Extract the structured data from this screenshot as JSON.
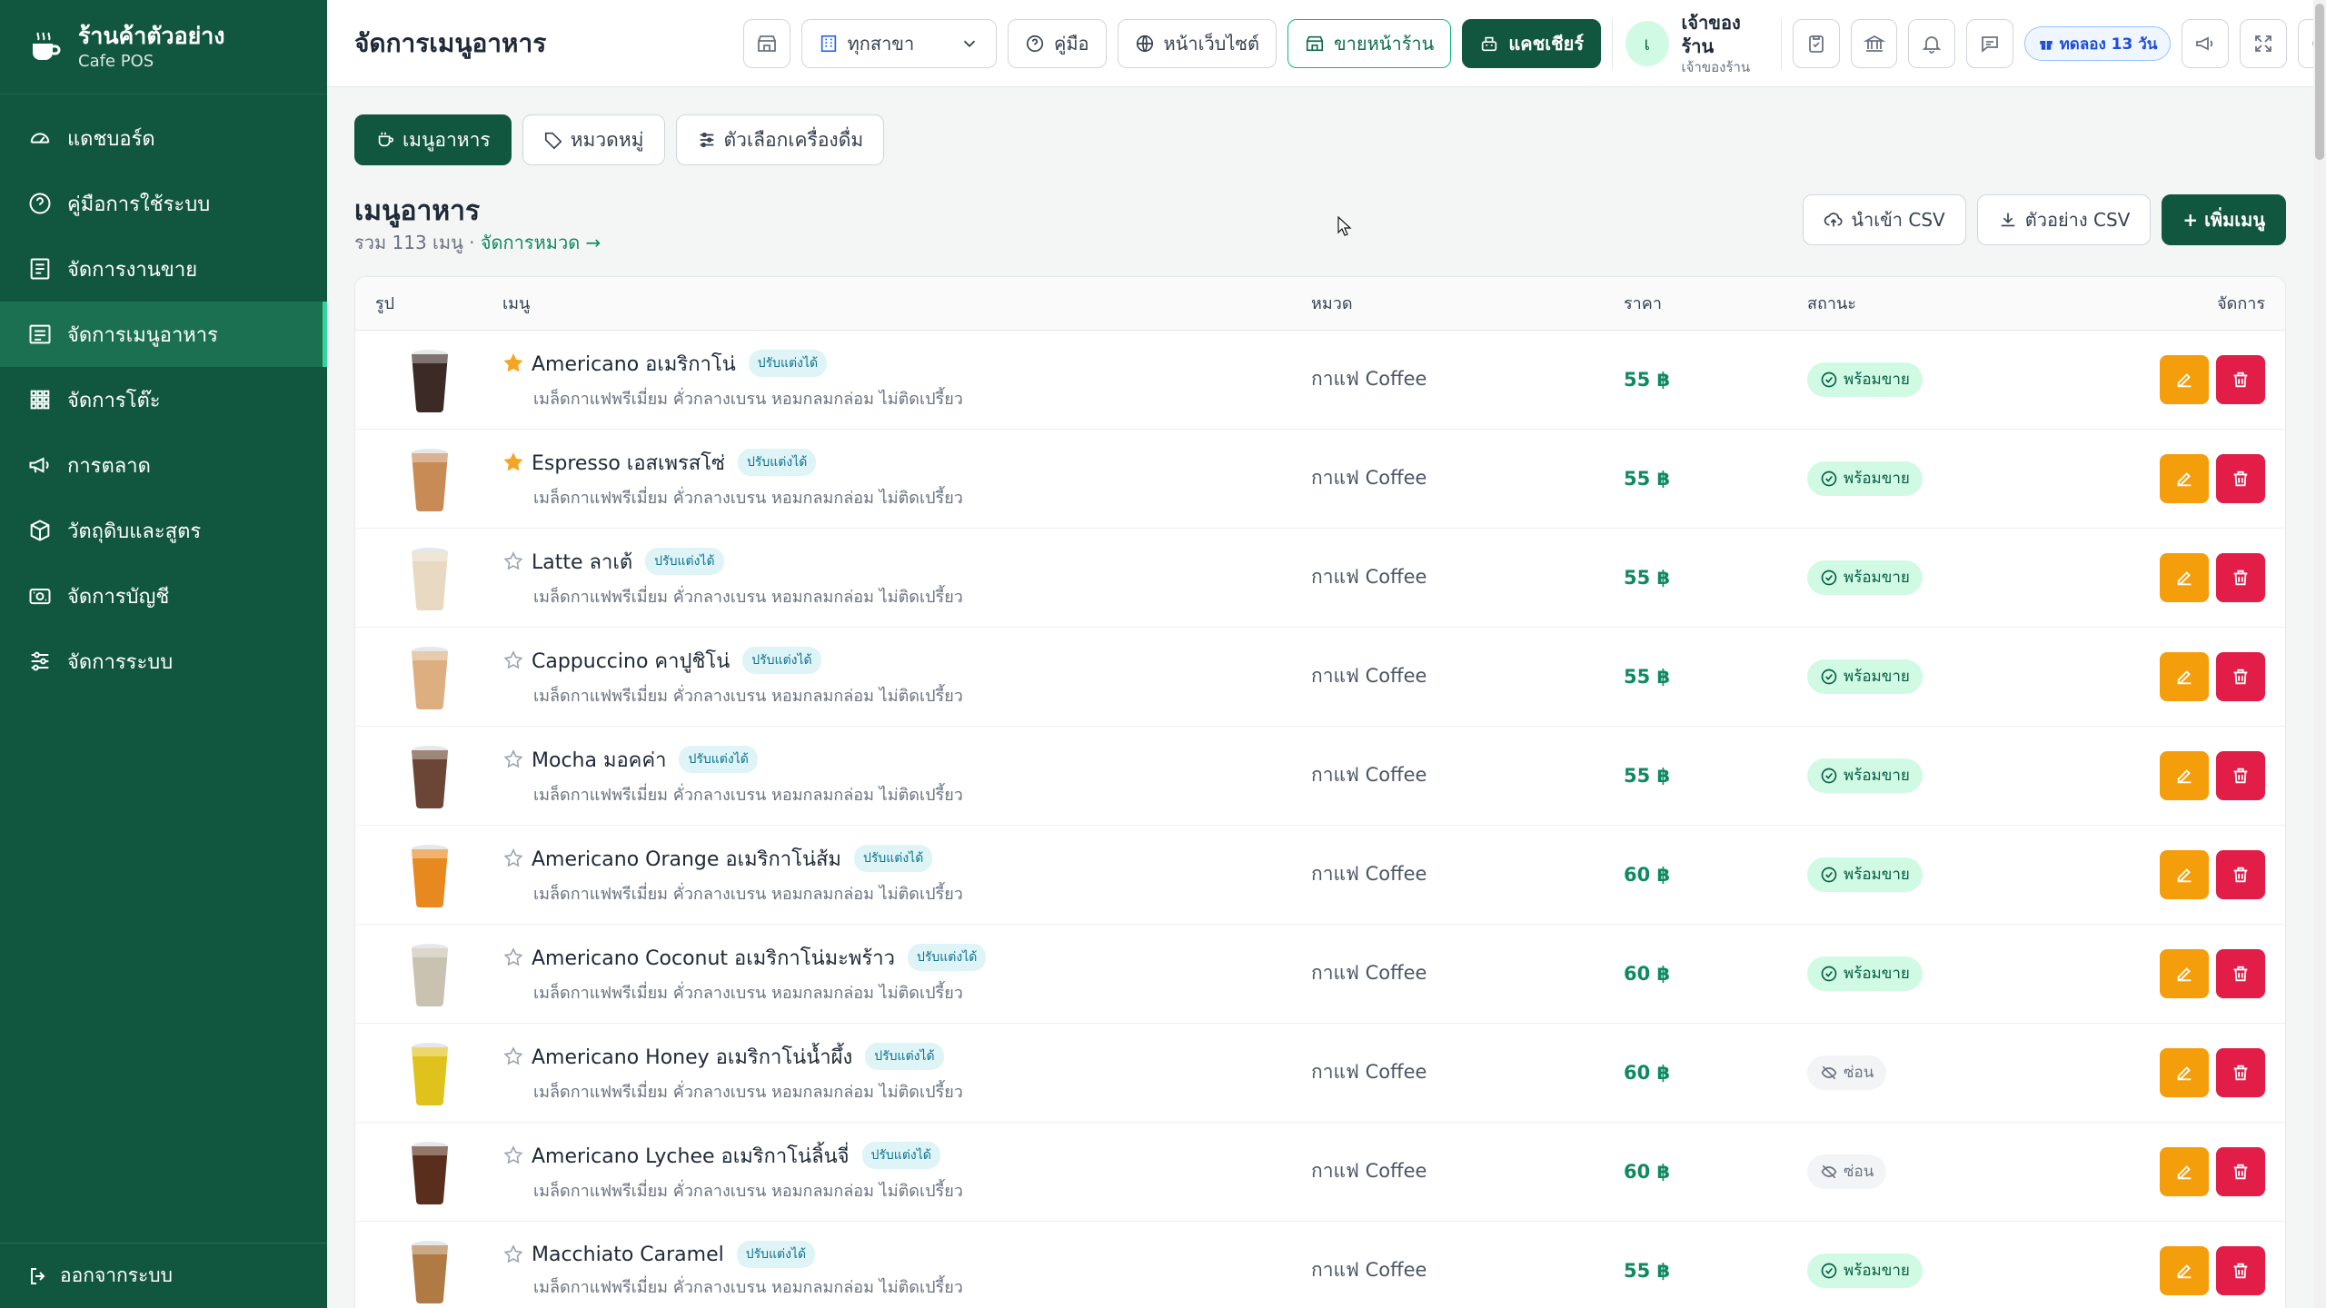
{
  "brand": {
    "name": "ร้านค้าตัวอย่าง",
    "sub": "Cafe POS"
  },
  "sidebar": {
    "items": [
      {
        "label": "แดชบอร์ด",
        "icon": "dashboard-gauge-icon",
        "active": false
      },
      {
        "label": "คู่มือการใช้ระบบ",
        "icon": "help-circle-icon",
        "active": false
      },
      {
        "label": "จัดการงานขาย",
        "icon": "sales-list-icon",
        "active": false
      },
      {
        "label": "จัดการเมนูอาหาร",
        "icon": "menu-list-icon",
        "active": true
      },
      {
        "label": "จัดการโต๊ะ",
        "icon": "table-grid-icon",
        "active": false
      },
      {
        "label": "การตลาด",
        "icon": "megaphone-icon",
        "active": false
      },
      {
        "label": "วัตถุดิบและสูตร",
        "icon": "box-icon",
        "active": false
      },
      {
        "label": "จัดการบัญชี",
        "icon": "money-icon",
        "active": false
      },
      {
        "label": "จัดการระบบ",
        "icon": "sliders-icon",
        "active": false
      }
    ],
    "logout": "ออกจากระบบ"
  },
  "topbar": {
    "title": "จัดการเมนูอาหาร",
    "branch_select": "ทุกสาขา",
    "guide": "คู่มือ",
    "website": "หน้าเว็บไซต์",
    "pos": "ขายหน้าร้าน",
    "cashier": "แคชเชียร์",
    "user": {
      "initial": "เ",
      "name": "เจ้าของร้าน",
      "role": "เจ้าของร้าน"
    },
    "trial": "ทดลอง 13 วัน"
  },
  "tabs": [
    {
      "label": "เมนูอาหาร",
      "active": true
    },
    {
      "label": "หมวดหมู่",
      "active": false
    },
    {
      "label": "ตัวเลือกเครื่องดื่ม",
      "active": false
    }
  ],
  "section": {
    "title": "เมนูอาหาร",
    "summary": "รวม 113 เมนู · ",
    "manage_link": "จัดการหมวด →",
    "import_csv": "นำเข้า CSV",
    "sample_csv": "ตัวอย่าง CSV",
    "add_menu": "+ เพิ่มเมนู"
  },
  "table": {
    "headers": {
      "image": "รูป",
      "menu": "เมนู",
      "category": "หมวด",
      "price": "ราคา",
      "status": "สถานะ",
      "actions": "จัดการ"
    },
    "rows": [
      {
        "name": "Americano อเมริกาโน่",
        "badge": "ปรับแต่งได้",
        "desc": "เมล็ดกาแฟพรีเมี่ยม คั่วกลางเบรน หอมกลมกล่อม ไม่ติดเปรี้ยว",
        "category": "กาแฟ Coffee",
        "price": "55 ฿",
        "status": "พร้อมขาย",
        "available": true,
        "starred": true,
        "cup": "#3b2a26"
      },
      {
        "name": "Espresso เอสเพรสโซ่",
        "badge": "ปรับแต่งได้",
        "desc": "เมล็ดกาแฟพรีเมี่ยม คั่วกลางเบรน หอมกลมกล่อม ไม่ติดเปรี้ยว",
        "category": "กาแฟ Coffee",
        "price": "55 ฿",
        "status": "พร้อมขาย",
        "available": true,
        "starred": true,
        "cup": "#c98b55"
      },
      {
        "name": "Latte ลาเต้",
        "badge": "ปรับแต่งได้",
        "desc": "เมล็ดกาแฟพรีเมี่ยม คั่วกลางเบรน หอมกลมกล่อม ไม่ติดเปรี้ยว",
        "category": "กาแฟ Coffee",
        "price": "55 ฿",
        "status": "พร้อมขาย",
        "available": true,
        "starred": false,
        "cup": "#e8d9c2"
      },
      {
        "name": "Cappuccino คาปูชิโน่",
        "badge": "ปรับแต่งได้",
        "desc": "เมล็ดกาแฟพรีเมี่ยม คั่วกลางเบรน หอมกลมกล่อม ไม่ติดเปรี้ยว",
        "category": "กาแฟ Coffee",
        "price": "55 ฿",
        "status": "พร้อมขาย",
        "available": true,
        "starred": false,
        "cup": "#dcae80"
      },
      {
        "name": "Mocha มอคค่า",
        "badge": "ปรับแต่งได้",
        "desc": "เมล็ดกาแฟพรีเมี่ยม คั่วกลางเบรน หอมกลมกล่อม ไม่ติดเปรี้ยว",
        "category": "กาแฟ Coffee",
        "price": "55 ฿",
        "status": "พร้อมขาย",
        "available": true,
        "starred": false,
        "cup": "#6b4535"
      },
      {
        "name": "Americano Orange อเมริกาโน่ส้ม",
        "badge": "ปรับแต่งได้",
        "desc": "เมล็ดกาแฟพรีเมี่ยม คั่วกลางเบรน หอมกลมกล่อม ไม่ติดเปรี้ยว",
        "category": "กาแฟ Coffee",
        "price": "60 ฿",
        "status": "พร้อมขาย",
        "available": true,
        "starred": false,
        "cup": "#e8891f"
      },
      {
        "name": "Americano Coconut อเมริกาโน่มะพร้าว",
        "badge": "ปรับแต่งได้",
        "desc": "เมล็ดกาแฟพรีเมี่ยม คั่วกลางเบรน หอมกลมกล่อม ไม่ติดเปรี้ยว",
        "category": "กาแฟ Coffee",
        "price": "60 ฿",
        "status": "พร้อมขาย",
        "available": true,
        "starred": false,
        "cup": "#c9c2b0"
      },
      {
        "name": "Americano Honey อเมริกาโน่น้ำผึ้ง",
        "badge": "ปรับแต่งได้",
        "desc": "เมล็ดกาแฟพรีเมี่ยม คั่วกลางเบรน หอมกลมกล่อม ไม่ติดเปรี้ยว",
        "category": "กาแฟ Coffee",
        "price": "60 ฿",
        "status": "ซ่อน",
        "available": false,
        "starred": false,
        "cup": "#e0c21c"
      },
      {
        "name": "Americano Lychee อเมริกาโน่ลิ้นจี่",
        "badge": "ปรับแต่งได้",
        "desc": "เมล็ดกาแฟพรีเมี่ยม คั่วกลางเบรน หอมกลมกล่อม ไม่ติดเปรี้ยว",
        "category": "กาแฟ Coffee",
        "price": "60 ฿",
        "status": "ซ่อน",
        "available": false,
        "starred": false,
        "cup": "#5a2e1c"
      },
      {
        "name": "Macchiato Caramel",
        "badge": "ปรับแต่งได้",
        "desc": "เมล็ดกาแฟพรีเมี่ยม คั่วกลางเบรน หอมกลมกล่อม ไม่ติดเปรี้ยว",
        "category": "กาแฟ Coffee",
        "price": "55 ฿",
        "status": "พร้อมขาย",
        "available": true,
        "starred": false,
        "cup": "#b07a45"
      }
    ]
  },
  "colors": {
    "sidebar": "#11573f",
    "accent": "#0f8a5f",
    "edit": "#f59e0b",
    "delete": "#e11d48",
    "star": "#f5a524"
  }
}
